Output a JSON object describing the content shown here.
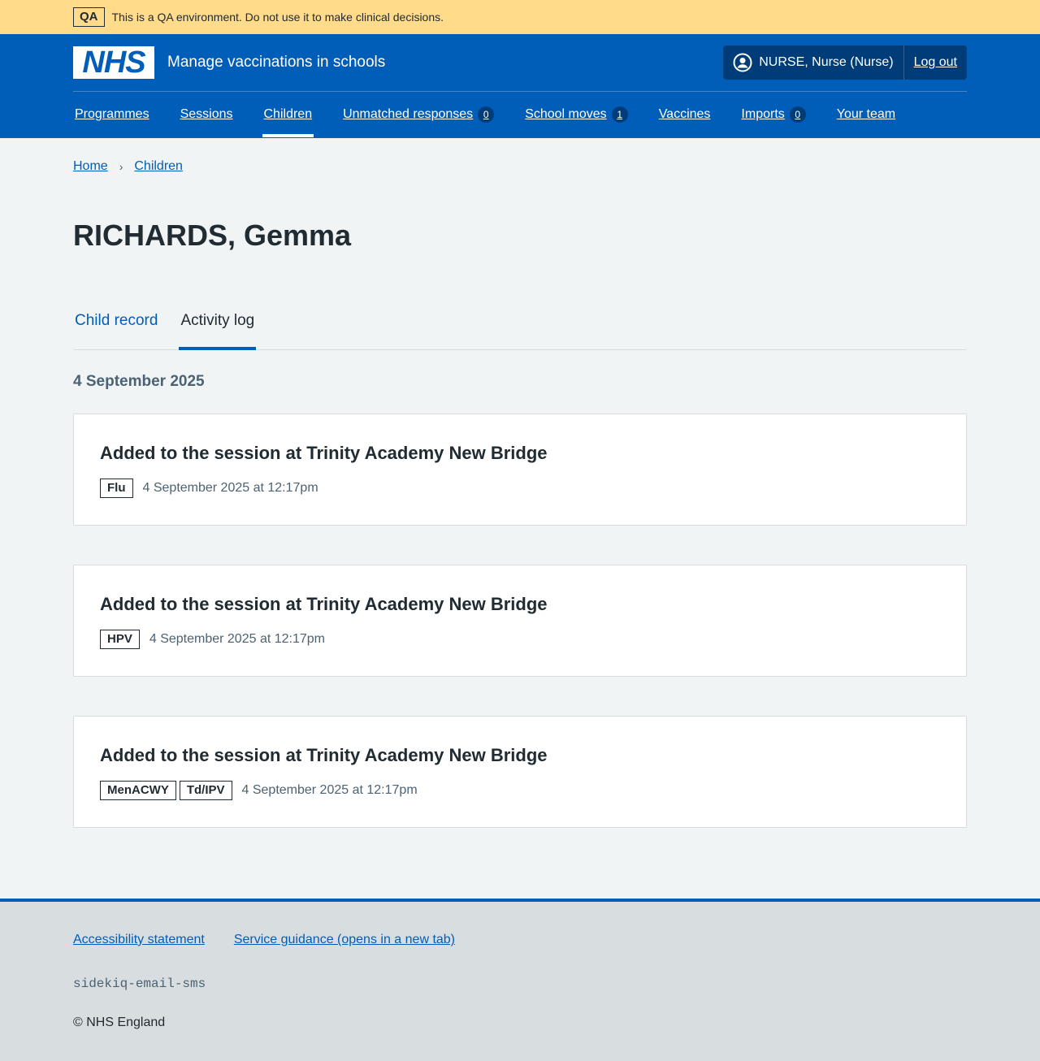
{
  "qa_banner": {
    "tag": "QA",
    "message": "This is a QA environment. Do not use it to make clinical decisions."
  },
  "header": {
    "logo": "NHS",
    "service_name": "Manage vaccinations in schools",
    "user": "NURSE, Nurse (Nurse)",
    "logout": "Log out"
  },
  "nav": {
    "items": [
      {
        "label": "Programmes"
      },
      {
        "label": "Sessions"
      },
      {
        "label": "Children",
        "active": true
      },
      {
        "label": "Unmatched responses",
        "count": "0"
      },
      {
        "label": "School moves",
        "count": "1"
      },
      {
        "label": "Vaccines"
      },
      {
        "label": "Imports",
        "count": "0"
      },
      {
        "label": "Your team"
      }
    ]
  },
  "breadcrumb": {
    "items": [
      "Home",
      "Children"
    ],
    "separator": "›"
  },
  "page": {
    "title": "RICHARDS, Gemma"
  },
  "tabs": [
    {
      "label": "Child record",
      "selected": false
    },
    {
      "label": "Activity log",
      "selected": true
    }
  ],
  "activity": {
    "date_heading": "4 September 2025",
    "events": [
      {
        "title": "Added to the session at Trinity Academy New Bridge",
        "tags": [
          "Flu"
        ],
        "timestamp": "4 September 2025 at 12:17pm"
      },
      {
        "title": "Added to the session at Trinity Academy New Bridge",
        "tags": [
          "HPV"
        ],
        "timestamp": "4 September 2025 at 12:17pm"
      },
      {
        "title": "Added to the session at Trinity Academy New Bridge",
        "tags": [
          "MenACWY",
          "Td/IPV"
        ],
        "timestamp": "4 September 2025 at 12:17pm"
      }
    ]
  },
  "footer": {
    "links": [
      "Accessibility statement",
      "Service guidance (opens in a new tab)"
    ],
    "code": "sidekiq-email-sms",
    "copyright": "© NHS England"
  },
  "colors": {
    "nhs_blue": "#005eb8",
    "dark_blue": "#003d78",
    "qa_banner": "#ffdb8a",
    "page_bg": "#f0f4f5",
    "text": "#212b32",
    "secondary_text": "#4c6272"
  },
  "icons": {
    "user": "user-circle-icon",
    "breadcrumb_chevron": "chevron-right-icon"
  }
}
